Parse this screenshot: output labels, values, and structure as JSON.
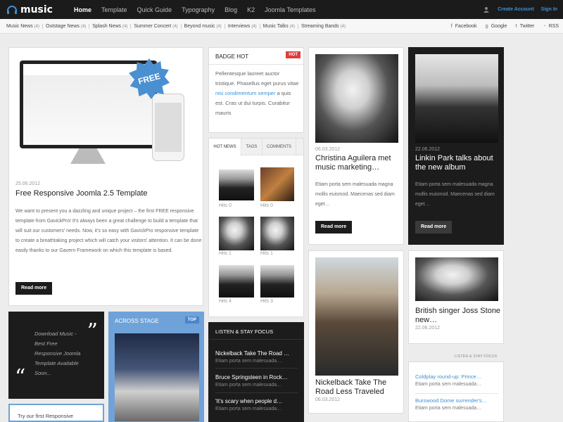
{
  "logo": {
    "text": "music"
  },
  "topnav": {
    "items": [
      "Home",
      "Template",
      "Quick Guide",
      "Typography",
      "Blog",
      "K2",
      "Joomla Templates"
    ]
  },
  "account": {
    "create": "Create Account",
    "signin": "Sign In"
  },
  "categories": [
    {
      "name": "Music News",
      "count": "(4)"
    },
    {
      "name": "Outstage News",
      "count": "(4)"
    },
    {
      "name": "Splash News",
      "count": "(4)"
    },
    {
      "name": "Summer Concert",
      "count": "(4)"
    },
    {
      "name": "Beyond music",
      "count": "(4)"
    },
    {
      "name": "Interviews",
      "count": "(4)"
    },
    {
      "name": "Music Talks",
      "count": "(4)"
    },
    {
      "name": "Streaming Bands",
      "count": "(4)"
    }
  ],
  "social": {
    "facebook": "Facebook",
    "google": "Google",
    "twitter": "Twitter",
    "rss": "RSS"
  },
  "featured": {
    "badge": "FREE",
    "date": "25.06.2012",
    "title": "Free Responsive Joomla 2.5 Template",
    "body": "We want to present you a dazzling and unique project – the first FREE responsive template from GavickPro! It's always been a great challenge to build a template that will suit our customers' needs. Now, it's so easy with GavickPro responsive template to create a breathtaking project which will catch your visitors' attention. It can be done easily thanks to our Gavern Framework on which this template is based.",
    "button": "Read more"
  },
  "badgehot": {
    "title": "BADGE HOT",
    "badge": "HOT",
    "text_before": "Pellentesque laoreet auctor tristique. Phasellus eget purus vitae ",
    "link": "nisi condimentum semper",
    "text_after": " a quis est. Cras ut dui turpis. Curabitur mauris"
  },
  "tabs": {
    "labels": [
      "HOT NEWS",
      "TAGS",
      "COMMENTS"
    ],
    "items": [
      {
        "hits": "Hits 0"
      },
      {
        "hits": "Hits 0"
      },
      {
        "hits": "Hits 1"
      },
      {
        "hits": "Hits 1"
      },
      {
        "hits": "Hits 4"
      },
      {
        "hits": "Hits 3"
      }
    ]
  },
  "christina": {
    "date": "06.03.2012",
    "title": "Christina Aguilera met music marketing…",
    "body": "Etiam porta sem malesuada magna mollis euismod. Maecenas sed diam eget…",
    "button": "Read more"
  },
  "linkin": {
    "date": "22.06.2012",
    "title": "Linkin Park talks about the new album",
    "body": "Etiam porta sem malesuada magna mollis euismod. Maecenas sed diam eget…",
    "button": "Read more"
  },
  "nickelback": {
    "title": "Nickelback Take The Road Less Traveled",
    "date": "06.03.2012"
  },
  "joss": {
    "title": "British singer Joss Stone new…",
    "date": "22.06.2012"
  },
  "quote": {
    "text": "Download Music - Best Free Responsive Joomla Template Available Soon..."
  },
  "across": {
    "title": "ACROSS STAGE",
    "badge": "TOP"
  },
  "listen": {
    "title": "LISTEN & STAY FOCUS",
    "items": [
      {
        "title": "Nickelback Take The Road …",
        "text": "Etiam porta sem malesuada…"
      },
      {
        "title": "Bruce Springsteen in Rock…",
        "text": "Etiam porta sem malesuada…"
      },
      {
        "title": "'It's scary when people d…",
        "text": "Etiam porta sem malesuada…"
      }
    ]
  },
  "listen_right": {
    "title": "LISTEN & STAY FOCUS",
    "items": [
      {
        "title": "Coldplay round-up: Prince…",
        "text": "Etiam porta sem malesuada…"
      },
      {
        "title": "Burswood Dome surrender's…",
        "text": "Etiam porta sem malesuada…"
      }
    ]
  },
  "try": {
    "text": "Try our first Responsive"
  }
}
